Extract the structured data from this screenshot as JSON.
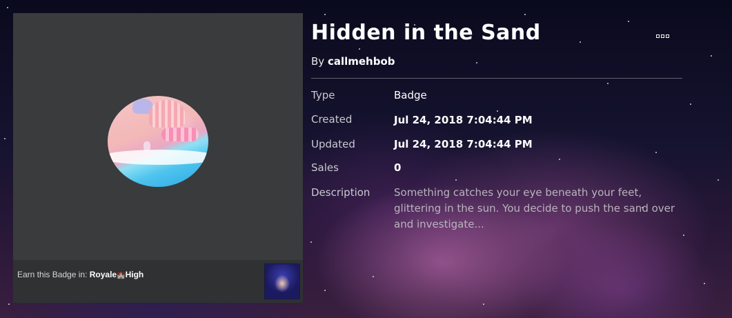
{
  "asset": {
    "title": "Hidden in the Sand",
    "by_prefix": "By",
    "creator": "callmehbob"
  },
  "details": {
    "type_label": "Type",
    "type_value": "Badge",
    "created_label": "Created",
    "created_value": "Jul 24, 2018 7:04:44 PM",
    "updated_label": "Updated",
    "updated_value": "Jul 24, 2018 7:04:44 PM",
    "sales_label": "Sales",
    "sales_value": "0",
    "description_label": "Description",
    "description_value": "Something catches your eye beneath your feet, glittering in the sun. You decide to push the sand over and investigate..."
  },
  "earn": {
    "prefix": "Earn this Badge in:",
    "game_name_part1": "Royale",
    "game_name_part2": "High"
  },
  "icons": {
    "menu": "more-options-icon",
    "castle": "castle-icon"
  },
  "colors": {
    "card_bg": "#393b3d",
    "earn_bar_bg": "#2f3133",
    "text_primary": "#ffffff"
  }
}
